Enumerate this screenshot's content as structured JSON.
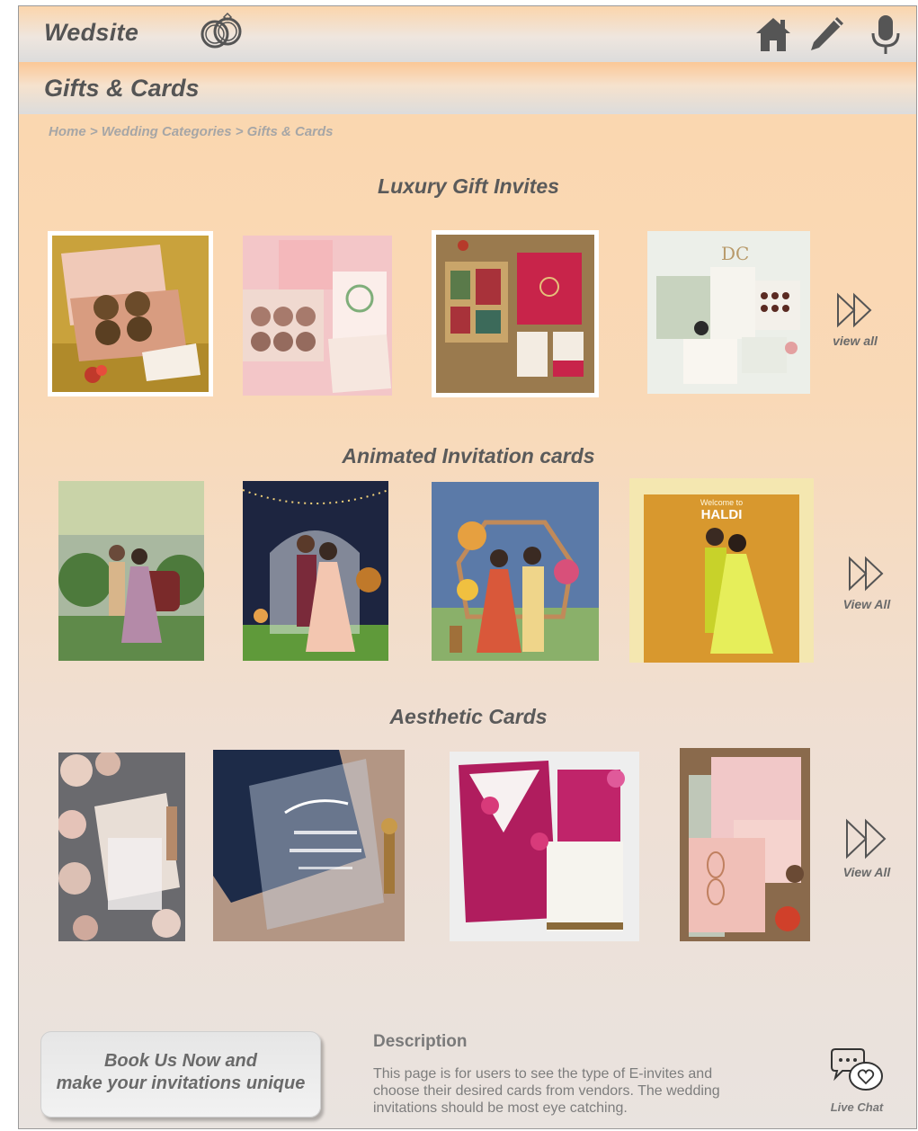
{
  "header": {
    "brand": "Wedsite",
    "icons": [
      "rings-icon",
      "home-icon",
      "edit-icon",
      "mic-icon"
    ]
  },
  "page": {
    "title": "Gifts & Cards",
    "breadcrumb": [
      "Home",
      "Wedding Categories",
      "Gifts & Cards"
    ],
    "breadcrumb_separator": " > "
  },
  "sections": [
    {
      "title": "Luxury Gift Invites",
      "view_all": "view all",
      "images": [
        "gold-gift-box",
        "pink-gift-hamper",
        "red-card-gift-box",
        "pastel-invitation-set"
      ]
    },
    {
      "title": "Animated Invitation cards",
      "view_all": "View All",
      "images": [
        "couple-garden-swing",
        "couple-fairy-lights",
        "couple-floral-arch",
        "haldi-couple"
      ],
      "image_text": {
        "haldi_welcome": "Welcome to",
        "haldi_title": "HALDI"
      }
    },
    {
      "title": "Aesthetic Cards",
      "view_all": "View All",
      "images": [
        "roses-card",
        "acrylic-navy-card",
        "magenta-envelope-card",
        "pink-lantern-card"
      ]
    }
  ],
  "footer": {
    "book_button_line1": "Book Us Now and",
    "book_button_line2": "make your invitations unique",
    "description_title": "Description",
    "description_text": "This page is for users to see the type of E-invites and choose their desired cards from vendors. The wedding invitations should be most eye catching.",
    "live_chat": "Live Chat"
  },
  "colors": {
    "bg_top": "#fbd6ad",
    "bg_bottom": "#e9e3df",
    "text_dark": "#555555",
    "text_muted": "#a6a6a6",
    "icon": "#555555"
  }
}
